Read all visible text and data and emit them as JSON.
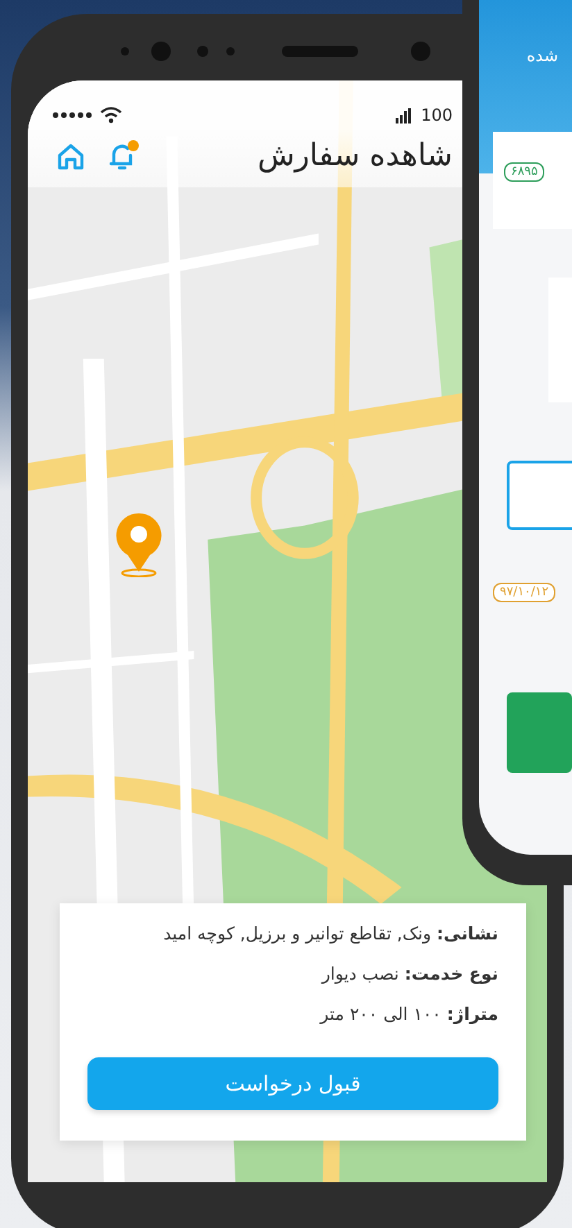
{
  "status_bar": {
    "signal_text": "100"
  },
  "header": {
    "title": "شاهده سفارش",
    "has_notification": true
  },
  "order_card": {
    "lines": [
      "**نشانی:** ونک, تقاطع توانیر و برزیل, کوچه امید",
      "**نوع خدمت:** نصب دیوار",
      "**متراژ:** ۱۰۰ الی ۲۰۰ متر"
    ],
    "button": "قبول درخواست"
  },
  "back_phone": {
    "header_text": "شده",
    "chips": [
      {
        "text": "۶۸۹۵",
        "color": "#2e9e5b"
      },
      {
        "text": "۹۷/۱۰/۱۲",
        "color": "#e0a030"
      }
    ]
  }
}
